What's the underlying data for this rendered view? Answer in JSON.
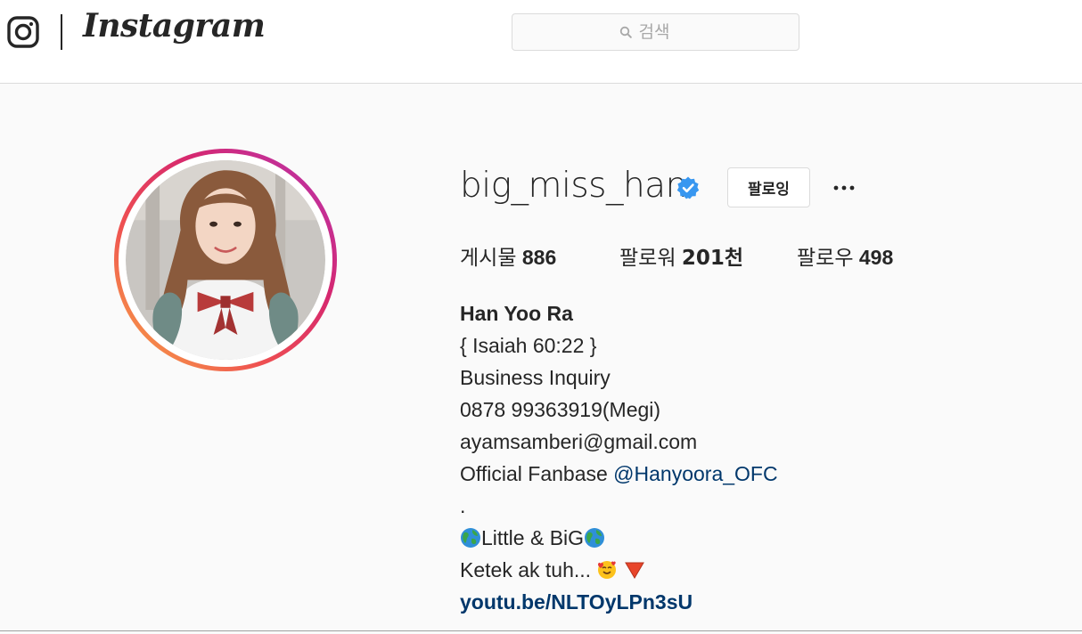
{
  "header": {
    "brand": "Instagram",
    "search_placeholder": "검색"
  },
  "profile": {
    "username": "big_miss_han",
    "verified": true,
    "follow_button": "팔로잉",
    "more_button": "...",
    "stats": {
      "posts_label": "게시물",
      "posts_value": "886",
      "followers_label": "팔로워",
      "followers_value": "201천",
      "following_label": "팔로우",
      "following_value": "498"
    },
    "bio": {
      "name": "Han Yoo Ra",
      "lines": [
        "{ Isaiah 60:22 }",
        "Business Inquiry",
        "0878 99363919(Megi)",
        "ayamsamberi@gmail.com"
      ],
      "fanbase_prefix": "Official Fanbase",
      "fanbase_handle": "@Hanyoora_OFC",
      "dot_line": ".",
      "little_big": "Little & BiG",
      "ketek": "Ketek ak tuh...",
      "link": "youtu.be/NLTOyLPn3sU"
    }
  },
  "colors": {
    "text": "#262626",
    "link": "#00376b",
    "verified": "#3897f0",
    "border": "#dbdbdb",
    "background": "#fafafa"
  }
}
